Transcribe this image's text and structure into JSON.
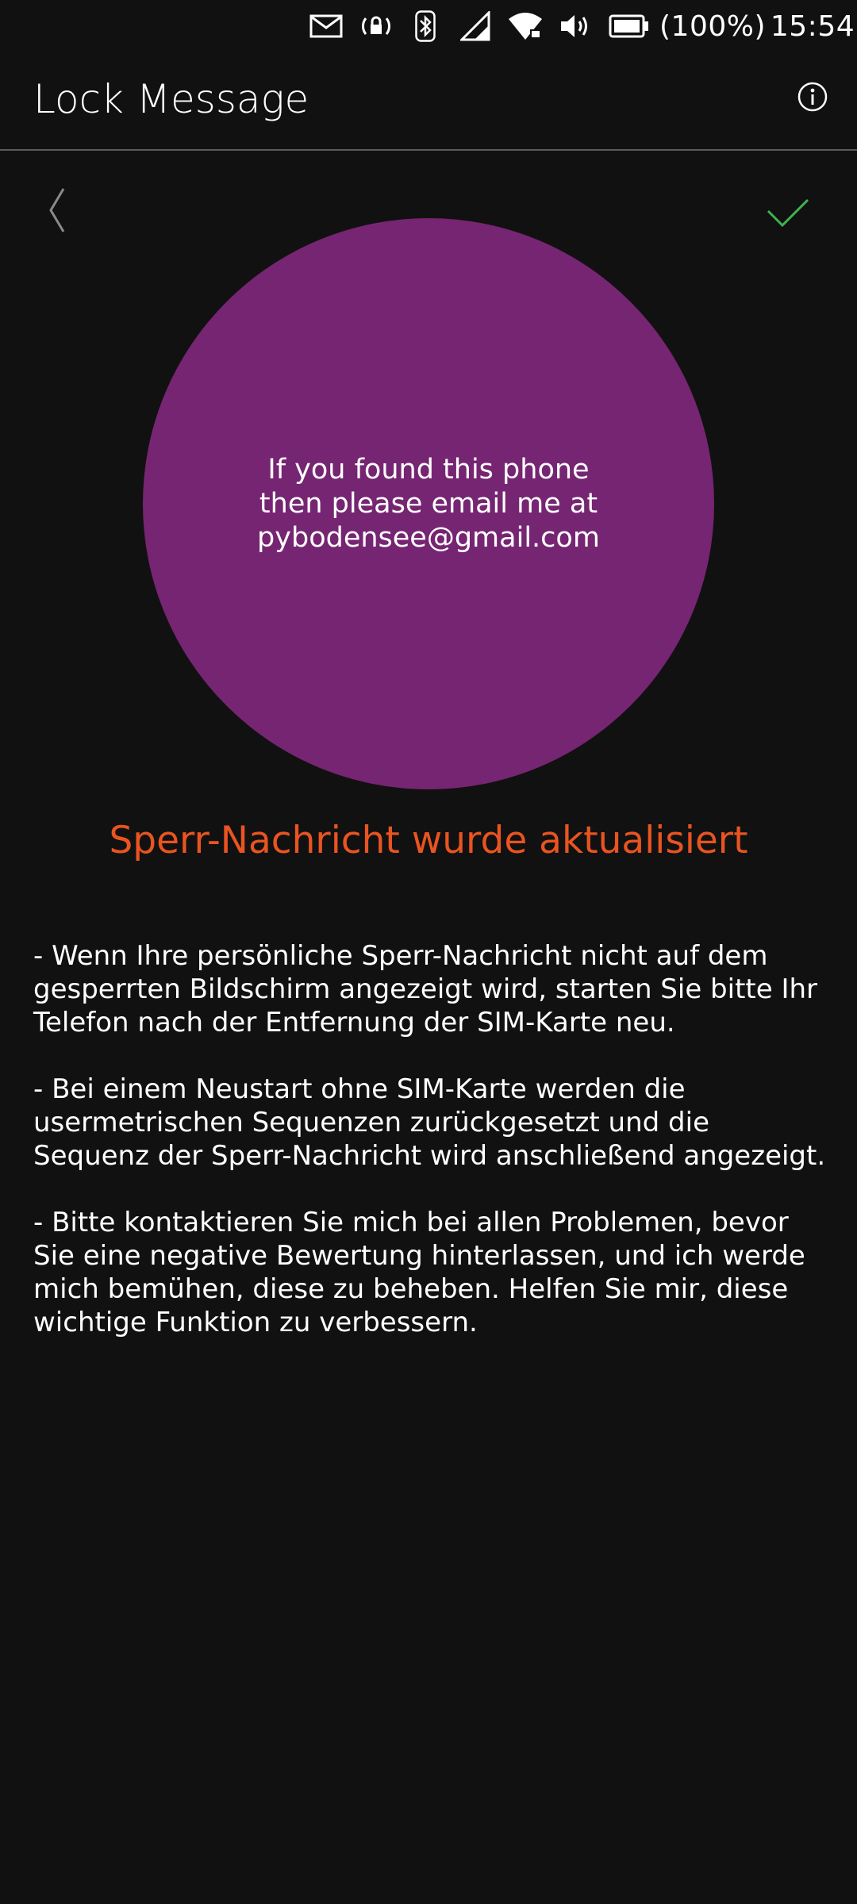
{
  "status_bar": {
    "icons": [
      "mail-icon",
      "rotation-lock-icon",
      "bluetooth-icon",
      "signal-icon",
      "wifi-icon",
      "volume-icon",
      "battery-icon"
    ],
    "battery_text": "(100%)",
    "time": "15:54"
  },
  "header": {
    "title": "Lock Message",
    "info_icon": "info-icon"
  },
  "nav": {
    "back_icon": "chevron-left-icon",
    "confirm_icon": "checkmark-icon",
    "confirm_color": "#3EB34F"
  },
  "message": {
    "text": "If you found this phone\nthen please email me at\npybodensee@gmail.com",
    "circle_color": "#762572"
  },
  "status_message": {
    "text": "Sperr-Nachricht wurde aktualisiert",
    "color": "#E95420"
  },
  "notes": [
    "- Wenn Ihre persönliche Sperr-Nachricht nicht auf dem gesperrten Bildschirm angezeigt wird, starten Sie bitte Ihr Telefon nach der Entfernung der SIM-Karte neu.",
    "- Bei einem Neustart ohne SIM-Karte werden die usermetrischen Sequenzen zurückgesetzt und die Sequenz der Sperr-Nachricht wird anschließend angezeigt.",
    "- Bitte kontaktieren Sie mich bei allen Problemen, bevor Sie eine negative Bewertung hinterlassen, und ich werde mich bemühen, diese zu beheben. Helfen Sie mir, diese wichtige Funktion zu verbessern."
  ]
}
